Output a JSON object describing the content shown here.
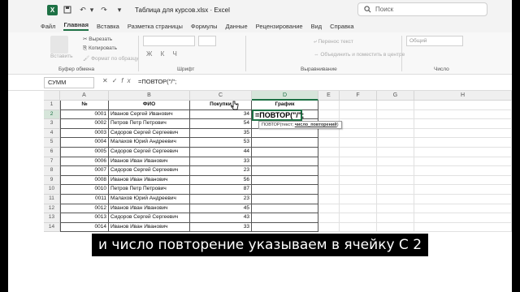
{
  "window": {
    "title": "Таблица для курсов.xlsx  ·  Excel",
    "search_placeholder": "Поиск"
  },
  "menu": {
    "tabs": [
      "Файл",
      "Главная",
      "Вставка",
      "Разметка страницы",
      "Формулы",
      "Данные",
      "Рецензирование",
      "Вид",
      "Справка"
    ],
    "active": "Главная"
  },
  "ribbon": {
    "paste": "Вставить",
    "cut": "Вырезать",
    "copy": "Копировать",
    "format_painter": "Формат по образцу",
    "clipboard_group": "Буфер обмена",
    "font_group": "Шрифт",
    "wrap_text": "Перенос текст",
    "merge_center": "Объединить и поместить в центре",
    "alignment_group": "Выравнивание",
    "number_format": "Общий",
    "number_group": "Число"
  },
  "formula_bar": {
    "name_box": "СУММ",
    "formula": "=ПОВТОР(\"/\";"
  },
  "grid": {
    "columns": [
      "A",
      "B",
      "C",
      "D",
      "E",
      "F",
      "G",
      "H"
    ],
    "active_column": "D",
    "active_row": "2",
    "headers": {
      "num": "№",
      "fio": "ФИО",
      "purchases": "Покупки",
      "chart": "График"
    },
    "rows": [
      {
        "n": "1"
      },
      {
        "n": "2",
        "id": "0001",
        "name": "Иванов Сергей Иванович",
        "val": "34"
      },
      {
        "n": "3",
        "id": "0002",
        "name": "Петров Петр Петрович",
        "val": "54"
      },
      {
        "n": "4",
        "id": "0003",
        "name": "Сидоров Сергей Сергеевич",
        "val": "35"
      },
      {
        "n": "5",
        "id": "0004",
        "name": "Малахов Юрий Андреевич",
        "val": "53"
      },
      {
        "n": "6",
        "id": "0005",
        "name": "Сидоров Сергей Сергеевич",
        "val": "44"
      },
      {
        "n": "7",
        "id": "0006",
        "name": "Иванов Иван Иванович",
        "val": "33"
      },
      {
        "n": "8",
        "id": "0007",
        "name": "Сидоров Сергей Сергеевич",
        "val": "23"
      },
      {
        "n": "9",
        "id": "0008",
        "name": "Иванов Иван Иванович",
        "val": "56"
      },
      {
        "n": "10",
        "id": "0010",
        "name": "Петров Петр Петрович",
        "val": "87"
      },
      {
        "n": "11",
        "id": "0011",
        "name": "Малахов Юрий Андреевич",
        "val": "23"
      },
      {
        "n": "12",
        "id": "0012",
        "name": "Иванов Иван Иванович",
        "val": "45"
      },
      {
        "n": "13",
        "id": "0013",
        "name": "Сидоров Сергей Сергеевич",
        "val": "43"
      },
      {
        "n": "14",
        "id": "0014",
        "name": "Иванов Иван Иванович",
        "val": "33"
      }
    ],
    "active_cell_text": "=ПОВТОР(\"/\";",
    "tooltip": {
      "fn": "ПОВТОР(текст; ",
      "arg": "число_повторений",
      "end": ")"
    }
  },
  "caption": "и число повторение указываем в ячейку С 2",
  "colors": {
    "accent": "#1e7145"
  }
}
